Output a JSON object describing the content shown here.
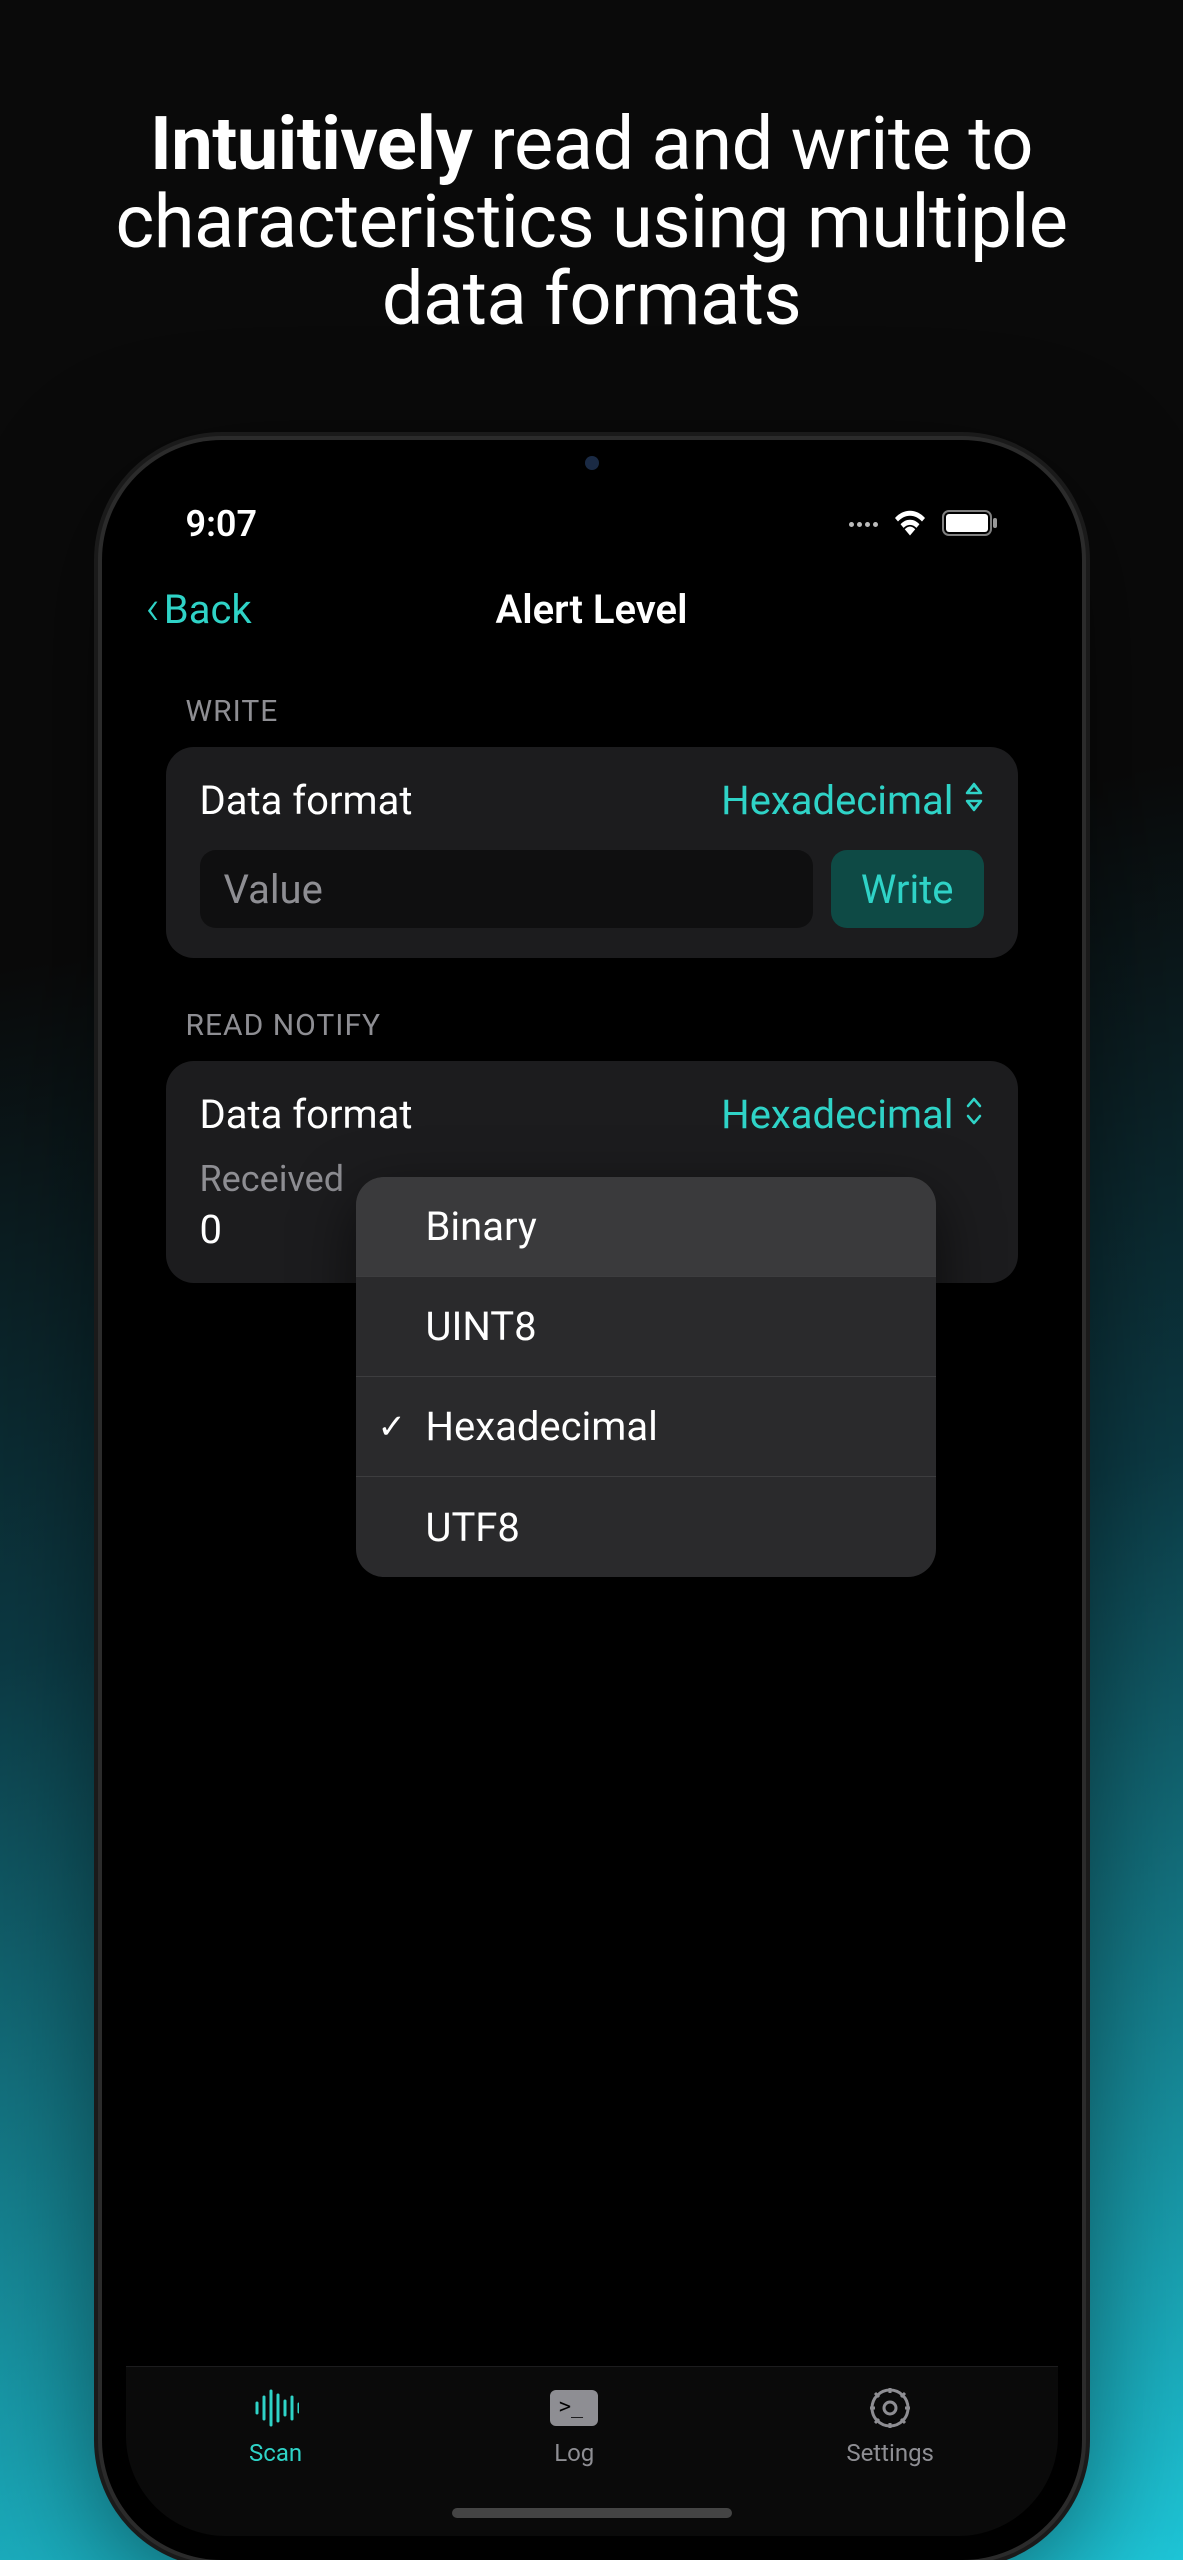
{
  "headline": {
    "bold": "Intuitively",
    "rest1": " read and write to",
    "line2": "characteristics using multiple",
    "line3": "data formats"
  },
  "status": {
    "time": "9:07"
  },
  "nav": {
    "back": "Back",
    "title": "Alert Level"
  },
  "write_section": {
    "header": "WRITE",
    "format_label": "Data format",
    "format_value": "Hexadecimal",
    "value_placeholder": "Value",
    "write_button": "Write"
  },
  "read_section": {
    "header": "READ NOTIFY",
    "format_label": "Data format",
    "format_value": "Hexadecimal",
    "received_label": "Received",
    "received_value": "0"
  },
  "dropdown": {
    "items": [
      {
        "label": "Binary",
        "selected": false
      },
      {
        "label": "UINT8",
        "selected": false
      },
      {
        "label": "Hexadecimal",
        "selected": true
      },
      {
        "label": "UTF8",
        "selected": false
      }
    ]
  },
  "tabs": {
    "scan": "Scan",
    "log": "Log",
    "settings": "Settings"
  }
}
